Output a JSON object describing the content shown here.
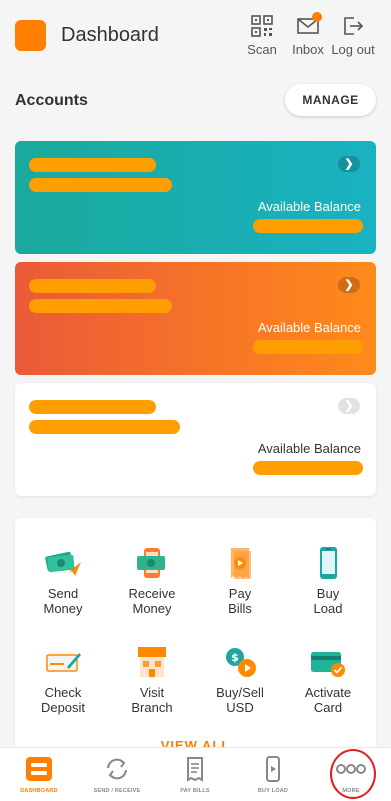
{
  "header": {
    "title": "Dashboard",
    "scan_label": "Scan",
    "inbox_label": "Inbox",
    "logout_label": "Log out"
  },
  "accounts": {
    "title": "Accounts",
    "manage_label": "MANAGE",
    "cards": [
      {
        "balance_label": "Available Balance",
        "color": "#1aa99c"
      },
      {
        "balance_label": "Available Balance",
        "color": "#ef6a2c"
      },
      {
        "balance_label": "Available Balance",
        "color": "#ffffff"
      }
    ]
  },
  "services": {
    "items": [
      {
        "label": "Send\nMoney",
        "icon": "send-money-icon"
      },
      {
        "label": "Receive\nMoney",
        "icon": "receive-money-icon"
      },
      {
        "label": "Pay\nBills",
        "icon": "pay-bills-icon"
      },
      {
        "label": "Buy\nLoad",
        "icon": "buy-load-icon"
      },
      {
        "label": "Check\nDeposit",
        "icon": "check-deposit-icon"
      },
      {
        "label": "Visit\nBranch",
        "icon": "visit-branch-icon"
      },
      {
        "label": "Buy/Sell\nUSD",
        "icon": "buy-sell-usd-icon"
      },
      {
        "label": "Activate\nCard",
        "icon": "activate-card-icon"
      }
    ],
    "view_all_label": "VIEW ALL"
  },
  "tabbar": {
    "tabs": [
      {
        "label": "DASHBOARD",
        "icon": "dashboard-icon",
        "active": true
      },
      {
        "label": "SEND / RECEIVE",
        "icon": "refresh-icon",
        "active": false
      },
      {
        "label": "PAY BILLS",
        "icon": "receipt-icon",
        "active": false
      },
      {
        "label": "BUY LOAD",
        "icon": "phone-icon",
        "active": false
      },
      {
        "label": "MORE",
        "icon": "more-dots-icon",
        "active": false
      }
    ]
  },
  "colors": {
    "accent": "#ff7f00",
    "placeholder_bar": "#ff9e00",
    "highlight_ring": "#e02020"
  }
}
